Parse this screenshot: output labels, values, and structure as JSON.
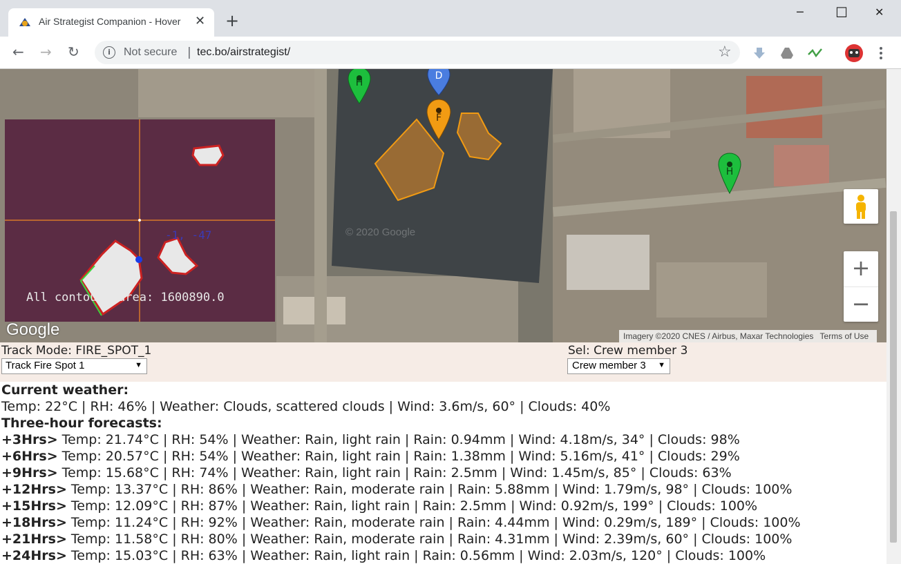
{
  "browser": {
    "tab_title": "Air Strategist Companion - Hover",
    "tab_close": "✕",
    "new_tab": "+",
    "window_controls": {
      "minimize": "─",
      "maximize": "☐",
      "close": "✕"
    },
    "nav": {
      "back": "←",
      "forward": "→",
      "reload": "↻"
    },
    "security_label": "Not secure",
    "separator": "|",
    "url": "tec.bo/airstrategist/",
    "star": "☆",
    "extension_icons": [
      "download-arrow-icon",
      "drive-icon",
      "activity-icon",
      "robot-avatar-icon",
      "menu-dots-icon"
    ]
  },
  "map": {
    "inset": {
      "overlay_text": "All contours area: 1600890.0",
      "coords_text": "-1, -47"
    },
    "watermark": "© 2020 Google",
    "google_logo": "Google",
    "attribution": {
      "imagery": "Imagery ©2020 CNES / Airbus, Maxar Technologies",
      "terms": "Terms of Use"
    },
    "markers": [
      {
        "label": "H",
        "color": "#1dbe3d"
      },
      {
        "label": "D",
        "color": "#4a7de0"
      },
      {
        "label": "F",
        "color": "#f29b13"
      },
      {
        "label": "H",
        "color": "#1dbe3d"
      }
    ],
    "zoom_in": "+",
    "zoom_out": "−"
  },
  "controls": {
    "track_mode": "Track Mode: FIRE_SPOT_1",
    "track_select": "Track Fire Spot 1",
    "sel_label": "Sel: Crew member 3",
    "crew_select": "Crew member 3",
    "caret": "▼"
  },
  "weather": {
    "current_heading": "Current weather:",
    "current": "Temp: 22°C | RH: 46% | Weather: Clouds, scattered clouds | Wind: 3.6m/s, 60° | Clouds: 40%",
    "forecast_heading": "Three-hour forecasts:",
    "forecasts": [
      {
        "label": "+3Hrs>",
        "text": " Temp: 21.74°C | RH: 54% | Weather: Rain, light rain | Rain: 0.94mm | Wind: 4.18m/s, 34° | Clouds: 98%"
      },
      {
        "label": "+6Hrs>",
        "text": " Temp: 20.57°C | RH: 54% | Weather: Rain, light rain | Rain: 1.38mm | Wind: 5.16m/s, 41° | Clouds: 29%"
      },
      {
        "label": "+9Hrs>",
        "text": " Temp: 15.68°C | RH: 74% | Weather: Rain, light rain | Rain: 2.5mm | Wind: 1.45m/s, 85° | Clouds: 63%"
      },
      {
        "label": "+12Hrs>",
        "text": " Temp: 13.37°C | RH: 86% | Weather: Rain, moderate rain | Rain: 5.88mm | Wind: 1.79m/s, 98° | Clouds: 100%"
      },
      {
        "label": "+15Hrs>",
        "text": " Temp: 12.09°C | RH: 87% | Weather: Rain, light rain | Rain: 2.5mm | Wind: 0.92m/s, 199° | Clouds: 100%"
      },
      {
        "label": "+18Hrs>",
        "text": " Temp: 11.24°C | RH: 92% | Weather: Rain, moderate rain | Rain: 4.44mm | Wind: 0.29m/s, 189° | Clouds: 100%"
      },
      {
        "label": "+21Hrs>",
        "text": " Temp: 11.58°C | RH: 80% | Weather: Rain, moderate rain | Rain: 4.31mm | Wind: 2.39m/s, 60° | Clouds: 100%"
      },
      {
        "label": "+24Hrs>",
        "text": " Temp: 15.03°C | RH: 63% | Weather: Rain, light rain | Rain: 0.56mm | Wind: 2.03m/s, 120° | Clouds: 100%"
      }
    ]
  }
}
